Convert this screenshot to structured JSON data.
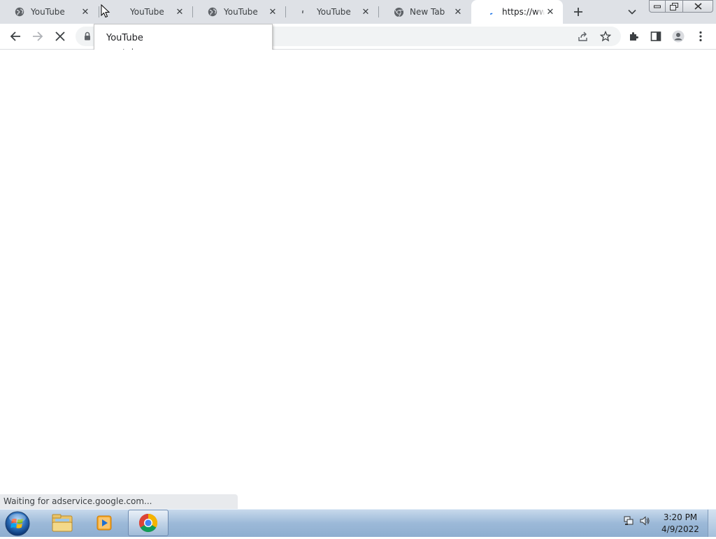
{
  "tabs": [
    {
      "title": "YouTube",
      "favicon": "globe-icon",
      "active": false
    },
    {
      "title": "YouTube",
      "favicon": "none",
      "active": false
    },
    {
      "title": "YouTube",
      "favicon": "globe-icon",
      "active": false
    },
    {
      "title": "YouTube",
      "favicon": "loading-spinner-icon",
      "active": false
    },
    {
      "title": "New Tab",
      "favicon": "chrome-icon",
      "active": false
    },
    {
      "title": "https://www.",
      "favicon": "loading-spinner-icon",
      "active": true
    }
  ],
  "hovercard": {
    "title": "YouTube",
    "domain": "youtube.com"
  },
  "status_bar": {
    "text": "Waiting for adservice.google.com..."
  },
  "taskbar": {
    "apps": [
      {
        "name": "Windows Explorer",
        "icon": "folder-icon",
        "active": false
      },
      {
        "name": "Windows Media Player",
        "icon": "media-player-icon",
        "active": false
      },
      {
        "name": "Google Chrome",
        "icon": "chrome-icon",
        "active": true
      }
    ],
    "clock": {
      "time": "3:20 PM",
      "date": "4/9/2022"
    }
  },
  "colors": {
    "tabstrip_bg": "#dee1e6",
    "active_tab_bg": "#ffffff",
    "omnibox_bg": "#f1f3f4",
    "taskbar_bg": "#9cb9d8"
  }
}
